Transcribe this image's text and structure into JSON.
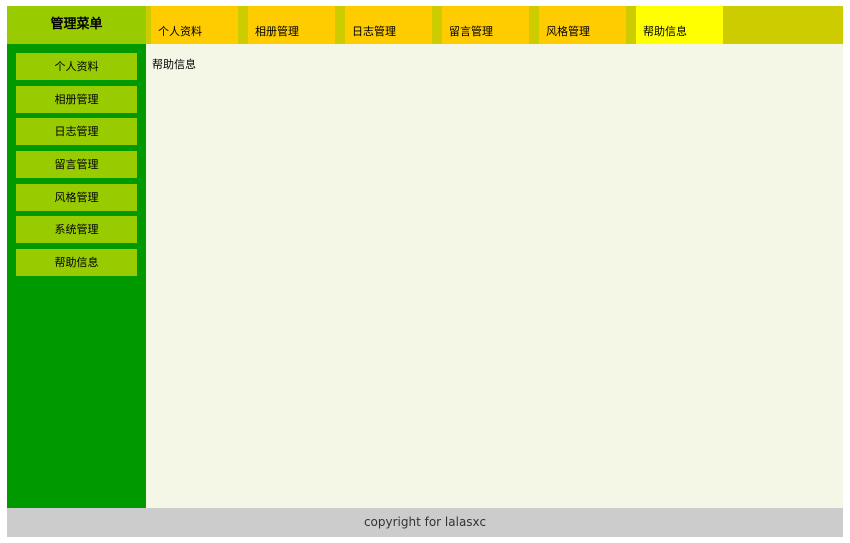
{
  "menu": {
    "title": "管理菜单"
  },
  "tabs": [
    {
      "label": "个人资料",
      "active": false
    },
    {
      "label": "相册管理",
      "active": false
    },
    {
      "label": "日志管理",
      "active": false
    },
    {
      "label": "留言管理",
      "active": false
    },
    {
      "label": "风格管理",
      "active": false
    },
    {
      "label": "帮助信息",
      "active": true
    }
  ],
  "sidebar": {
    "items": [
      {
        "label": "个人资料"
      },
      {
        "label": "相册管理"
      },
      {
        "label": "日志管理"
      },
      {
        "label": "留言管理"
      },
      {
        "label": "风格管理"
      },
      {
        "label": "系统管理"
      },
      {
        "label": "帮助信息"
      }
    ]
  },
  "content": {
    "text": "帮助信息"
  },
  "footer": {
    "text": "copyright for lalasxc"
  },
  "colors": {
    "top_bar": "#cccc00",
    "menu_title_bg": "#99cc00",
    "tab_bg": "#ffcc00",
    "tab_active_bg": "#ffff00",
    "sidebar_bg": "#009900",
    "sidebar_item_bg": "#99cc00",
    "content_bg": "#f5f7e6",
    "footer_bg": "#cccccc"
  }
}
